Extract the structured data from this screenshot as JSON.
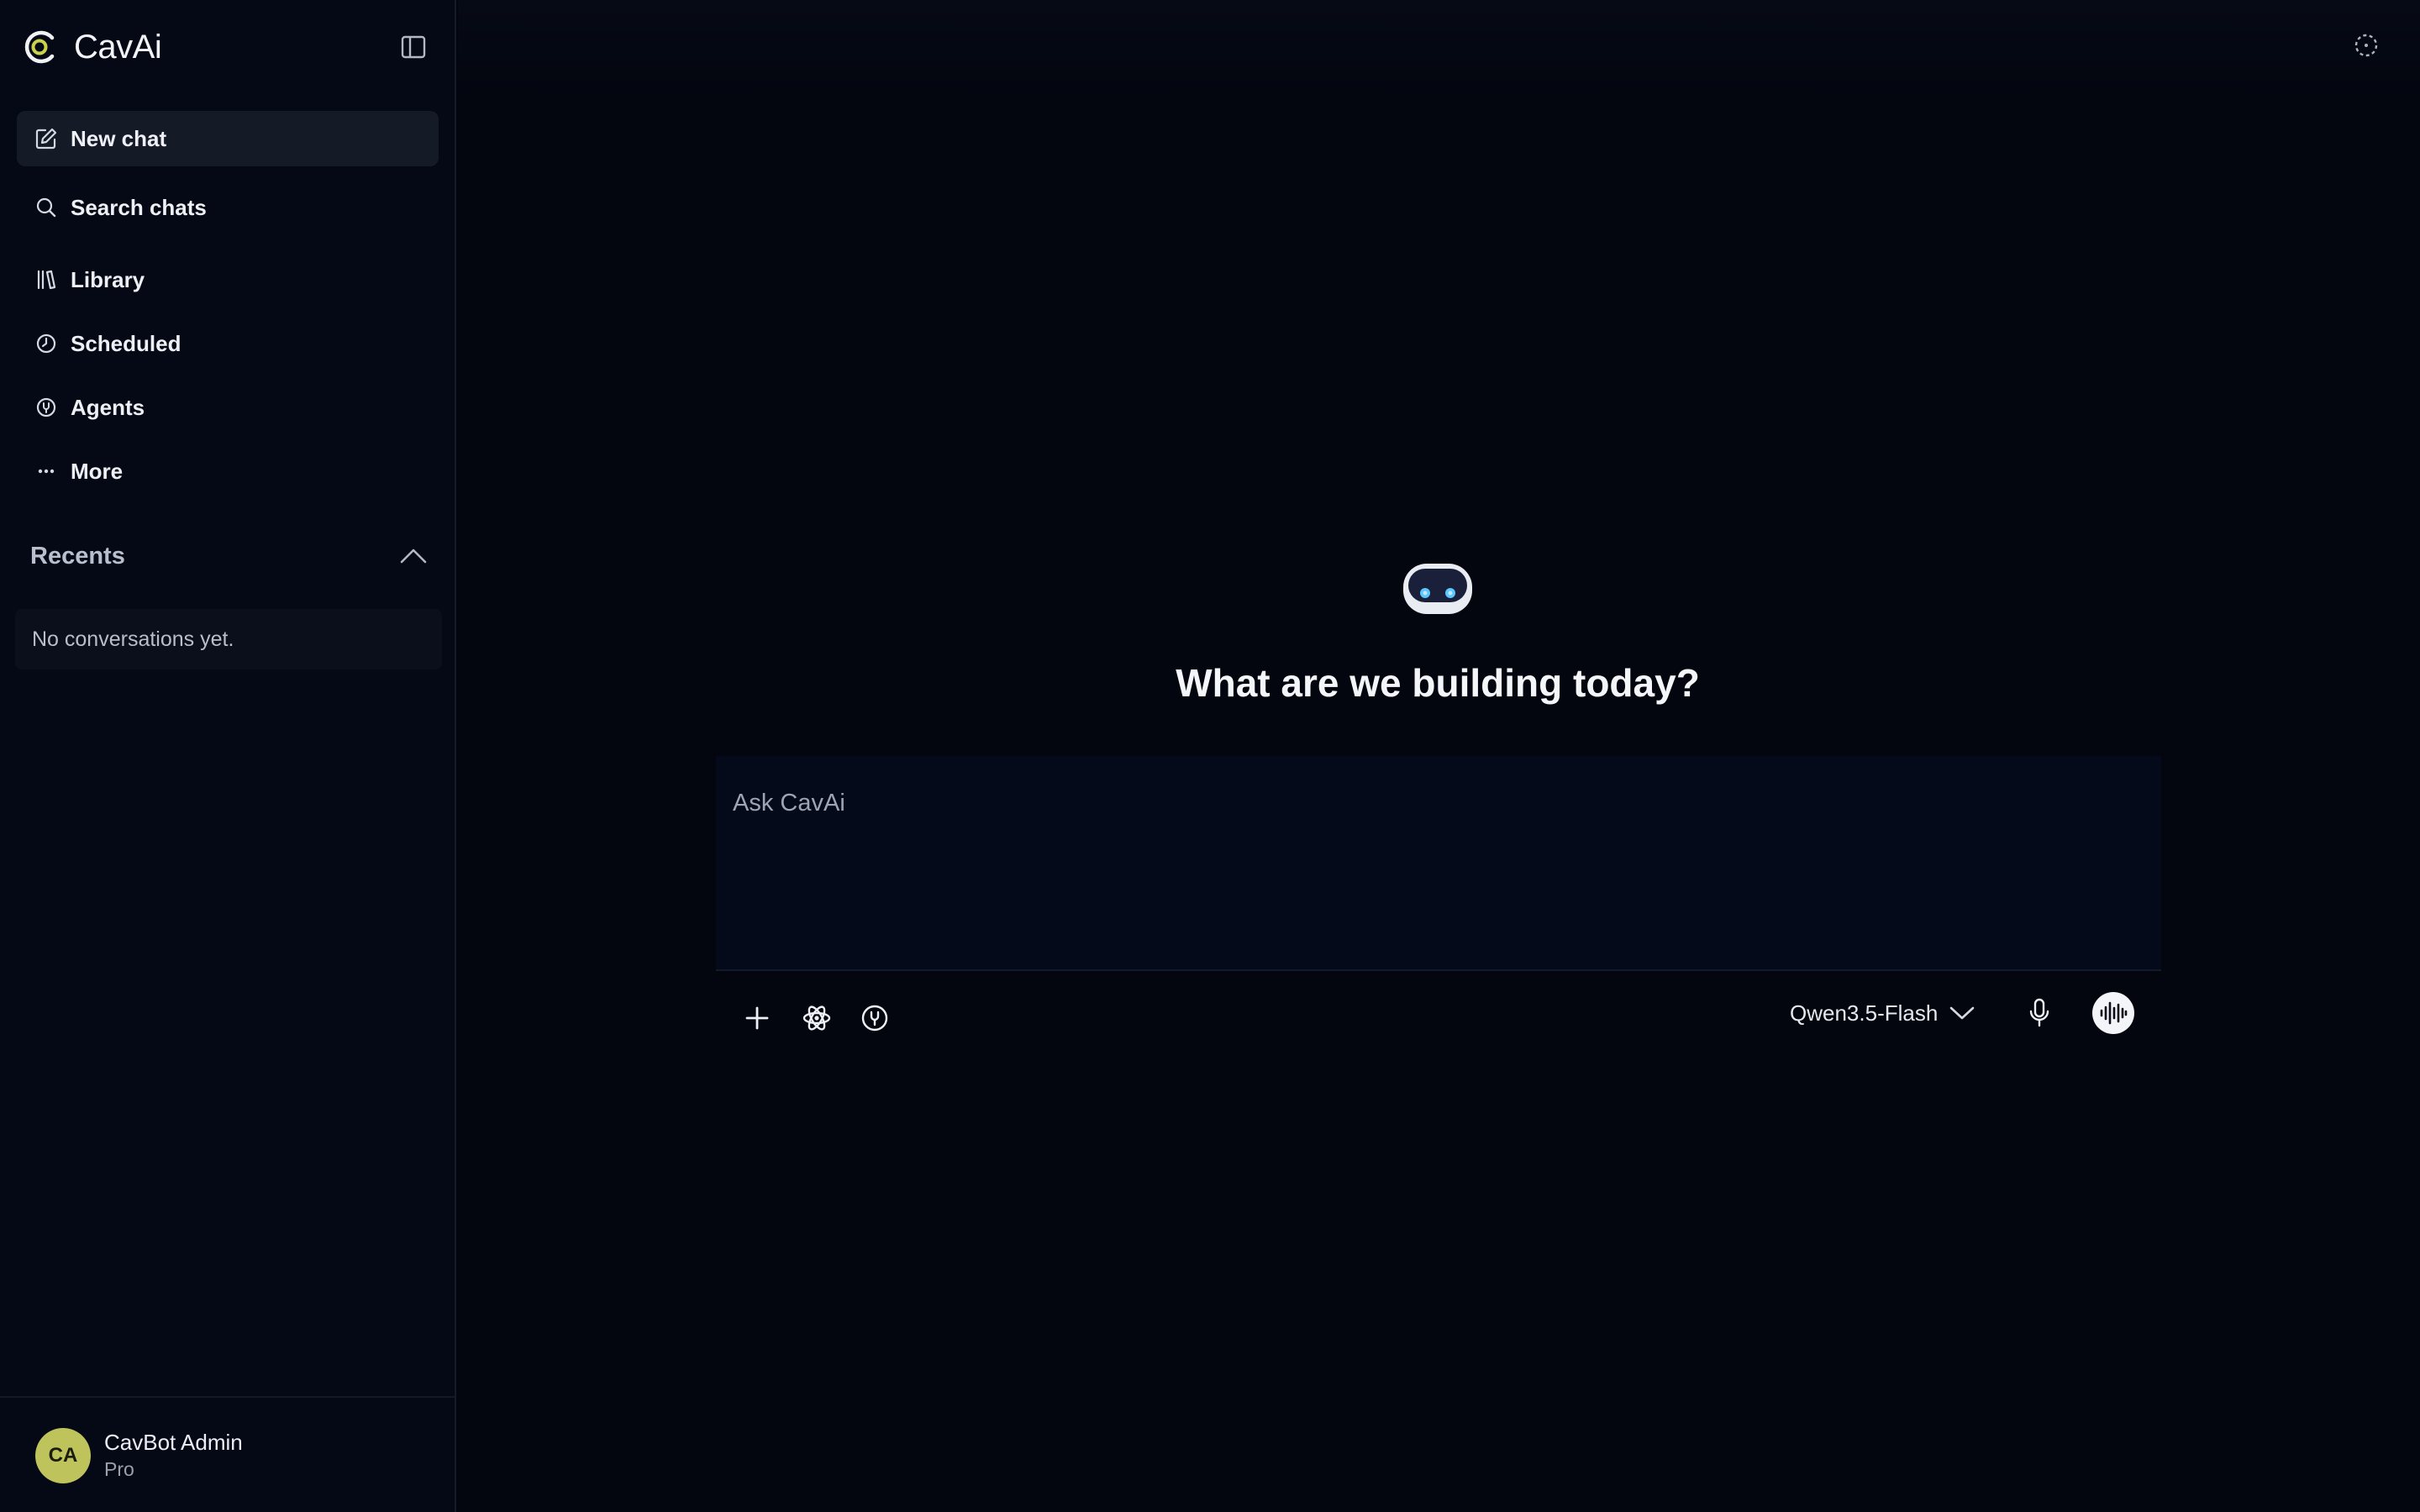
{
  "brand": {
    "name": "CavAi",
    "accent": "#c9d24a"
  },
  "sidebar": {
    "toggle_icon": "sidebar-panel-icon",
    "items": [
      {
        "label": "New chat",
        "icon": "new-chat-icon",
        "active": true
      },
      {
        "label": "Search chats",
        "icon": "search-icon"
      },
      {
        "label": "Library",
        "icon": "library-icon"
      },
      {
        "label": "Scheduled",
        "icon": "clock-icon"
      },
      {
        "label": "Agents",
        "icon": "agents-icon"
      },
      {
        "label": "More",
        "icon": "more-dots-icon"
      }
    ],
    "recents": {
      "title": "Recents",
      "empty_text": "No conversations yet."
    },
    "user": {
      "initials": "CA",
      "name": "CavBot Admin",
      "plan": "Pro",
      "avatar_color": "#bec35b"
    }
  },
  "main": {
    "headline": "What are we building today?",
    "composer": {
      "placeholder": "Ask CavAi",
      "model": "Qwen3.5-Flash"
    }
  }
}
